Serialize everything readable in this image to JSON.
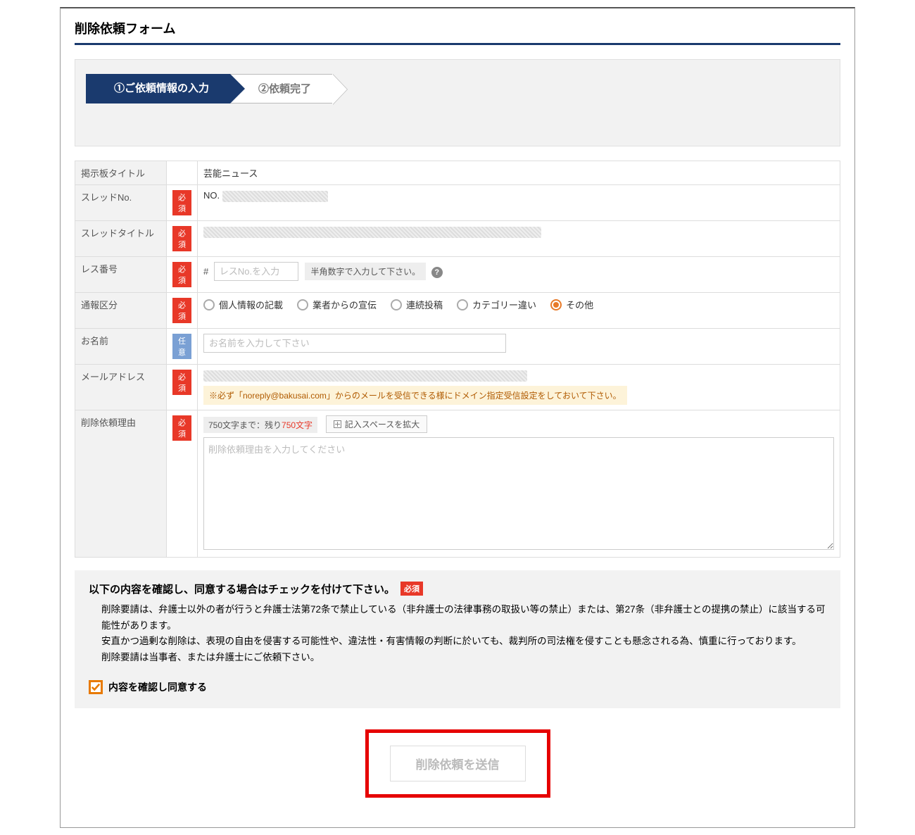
{
  "title": "削除依頼フォーム",
  "steps": {
    "s1": "①ご依頼情報の入力",
    "s2": "②依頼完了"
  },
  "badges": {
    "required": "必須",
    "optional": "任意"
  },
  "labels": {
    "board_title": "掲示板タイトル",
    "thread_no": "スレッドNo.",
    "thread_title": "スレッドタイトル",
    "res_no": "レス番号",
    "report_type": "通報区分",
    "name": "お名前",
    "email": "メールアドレス",
    "reason": "削除依頼理由"
  },
  "values": {
    "board_title": "芸能ニュース",
    "thread_no_prefix": "NO.",
    "res_prefix": "#",
    "res_placeholder": "レスNo.を入力",
    "res_hint": "半角数字で入力して下さい。",
    "name_placeholder": "お名前を入力して下さい",
    "email_note": "※必ず「noreply@bakusai.com」からのメールを受信できる様にドメイン指定受信設定をしておいて下さい。",
    "charcount_prefix": "750文字まで：残り",
    "charcount_remain": "750文字",
    "expand": "記入スペースを拡大",
    "reason_placeholder": "削除依頼理由を入力してください"
  },
  "report_options": [
    "個人情報の記載",
    "業者からの宣伝",
    "連続投稿",
    "カテゴリー違い",
    "その他"
  ],
  "report_selected": 4,
  "agree": {
    "heading": "以下の内容を確認し、同意する場合はチェックを付けて下さい。",
    "text": "削除要請は、弁護士以外の者が行うと弁護士法第72条で禁止している（非弁護士の法律事務の取扱い等の禁止）または、第27条（非弁護士との提携の禁止）に該当する可能性があります。\n安直かつ過剰な削除は、表現の自由を侵害する可能性や、違法性・有害情報の判断に於いても、裁判所の司法権を侵すことも懸念される為、慎重に行っております。\n削除要請は当事者、または弁護士にご依頼下さい。",
    "checkbox_label": "内容を確認し同意する",
    "checked": true
  },
  "submit": "削除依頼を送信"
}
